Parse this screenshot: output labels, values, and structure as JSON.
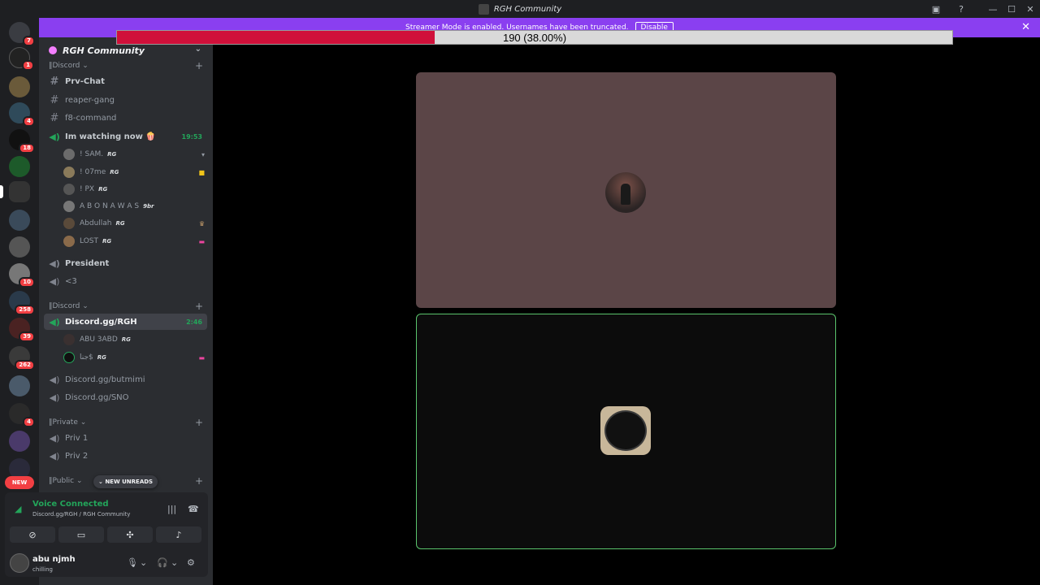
{
  "window": {
    "title": "RGH Community"
  },
  "banner": {
    "text": "Streamer Mode is enabled. Usernames have been truncated.",
    "disable_label": "Disable",
    "color": "#8a3ff0"
  },
  "progress": {
    "label": "190 (38.00%)",
    "value_percent": 38
  },
  "servers": {
    "badges": [
      "7",
      "1",
      "4",
      "18",
      "10",
      "258",
      "39",
      "262",
      "4"
    ],
    "new_label": "NEW"
  },
  "guild": {
    "name": "RGH Community"
  },
  "categories": {
    "c1": "Discord",
    "c2": "Discord",
    "c3": "Private",
    "c4": "Public"
  },
  "channels": {
    "prv_chat": "Prv-Chat",
    "reaper_gang": "reaper-gang",
    "f8_command": "f8-command",
    "watching": "Im watching now 🍿",
    "watching_time": "19:53",
    "president": "President",
    "heart": "<3",
    "discord_rgh": "Discord.gg/RGH",
    "discord_rgh_time": "2:46",
    "butmimi": "Discord.gg/butmimi",
    "sno": "Discord.gg/SNO",
    "priv1": "Priv 1",
    "priv2": "Priv 2"
  },
  "voice_users_1": [
    {
      "name": "! SAM.",
      "tag": "RG"
    },
    {
      "name": "! 07me",
      "tag": "RG"
    },
    {
      "name": "! PX",
      "tag": "RG"
    },
    {
      "name": "A B O N A W A S",
      "tag": "9br"
    },
    {
      "name": "Abdullah",
      "tag": "RG"
    },
    {
      "name": "LOST",
      "tag": "RG"
    }
  ],
  "voice_users_2": [
    {
      "name": "ABU 3ABD",
      "tag": "RG"
    },
    {
      "name": "جنا$",
      "tag": "RG"
    }
  ],
  "new_unreads": "NEW UNREADS",
  "voice_panel": {
    "status": "Voice Connected",
    "channel": "Discord.gg/RGH / RGH Community"
  },
  "user": {
    "name": "abu njmh",
    "status": "chilling"
  },
  "colors": {
    "accent_green": "#23a55a",
    "live_border": "#5ac46c",
    "tile1_bg": "#5b4547"
  }
}
